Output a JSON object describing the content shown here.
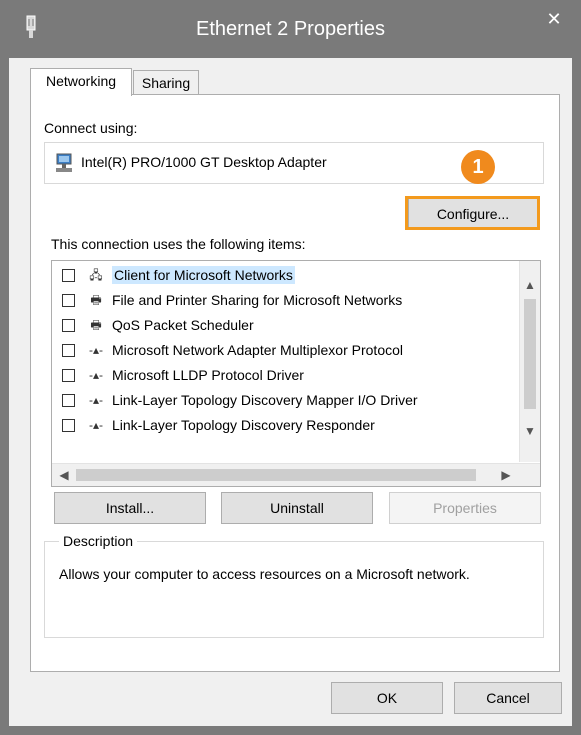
{
  "window": {
    "title": "Ethernet 2 Properties"
  },
  "tabs": [
    {
      "label": "Networking"
    },
    {
      "label": "Sharing"
    }
  ],
  "connect": {
    "label": "Connect using:",
    "adapter_name": "Intel(R) PRO/1000 GT Desktop Adapter",
    "configure_label": "Configure...",
    "callout_number": "1"
  },
  "items": {
    "label": "This connection uses the following items:",
    "list": [
      {
        "label": "Client for Microsoft Networks",
        "icon": "network-client-icon",
        "checked": false,
        "selected": true
      },
      {
        "label": "File and Printer Sharing for Microsoft Networks",
        "icon": "printer-icon",
        "checked": false
      },
      {
        "label": "QoS Packet Scheduler",
        "icon": "printer-icon",
        "checked": false
      },
      {
        "label": "Microsoft Network Adapter Multiplexor Protocol",
        "icon": "protocol-icon",
        "checked": false
      },
      {
        "label": "Microsoft LLDP Protocol Driver",
        "icon": "protocol-icon",
        "checked": false
      },
      {
        "label": "Link-Layer Topology Discovery Mapper I/O Driver",
        "icon": "protocol-icon",
        "checked": false
      },
      {
        "label": "Link-Layer Topology Discovery Responder",
        "icon": "protocol-icon",
        "checked": false
      }
    ]
  },
  "buttons": {
    "install": "Install...",
    "uninstall": "Uninstall",
    "properties": "Properties",
    "ok": "OK",
    "cancel": "Cancel"
  },
  "description": {
    "legend": "Description",
    "text": "Allows your computer to access resources on a Microsoft network."
  },
  "colors": {
    "titlebar": "#7a7a7a",
    "accent": "#f08a1d",
    "selection": "#cde8ff"
  }
}
